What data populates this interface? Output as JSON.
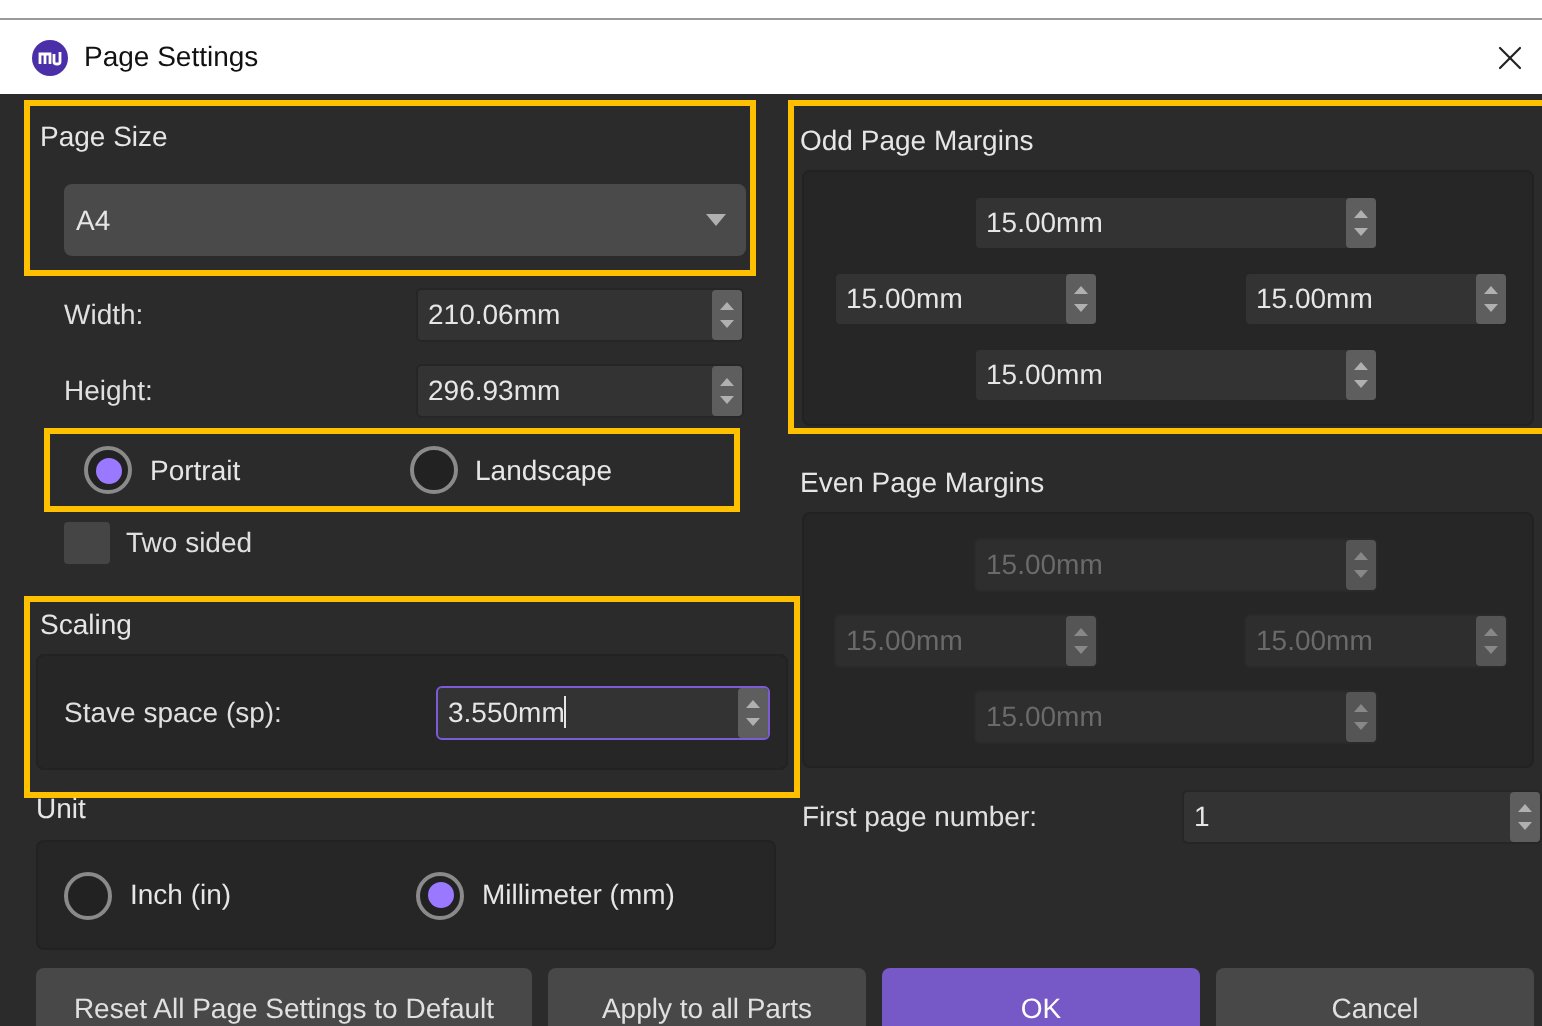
{
  "window": {
    "title": "Page Settings"
  },
  "page_size": {
    "title": "Page Size",
    "highlighted": true,
    "value": "A4",
    "width_label": "Width:",
    "width": "210.06mm",
    "height_label": "Height:",
    "height": "296.93mm"
  },
  "orientation": {
    "highlighted": true,
    "options": [
      {
        "label": "Portrait",
        "selected": true
      },
      {
        "label": "Landscape",
        "selected": false
      }
    ]
  },
  "two_sided": {
    "label": "Two sided",
    "checked": false
  },
  "scaling": {
    "title": "Scaling",
    "highlighted": true,
    "label": "Stave space (sp):",
    "value": "3.550mm",
    "focused": true
  },
  "unit": {
    "title": "Unit",
    "options": [
      {
        "label": "Inch (in)",
        "selected": false
      },
      {
        "label": "Millimeter (mm)",
        "selected": true
      }
    ]
  },
  "odd_margins": {
    "title": "Odd Page Margins",
    "highlighted": true,
    "disabled": false,
    "top": "15.00mm",
    "left": "15.00mm",
    "right": "15.00mm",
    "bottom": "15.00mm"
  },
  "even_margins": {
    "title": "Even Page Margins",
    "highlighted": false,
    "disabled": true,
    "top": "15.00mm",
    "left": "15.00mm",
    "right": "15.00mm",
    "bottom": "15.00mm"
  },
  "first_page_number": {
    "label": "First page number:",
    "value": "1"
  },
  "buttons": [
    {
      "label": "Reset All Page Settings to Default",
      "kind": "normal"
    },
    {
      "label": "Apply to all Parts",
      "kind": "normal"
    },
    {
      "label": "OK",
      "kind": "primary"
    },
    {
      "label": "Cancel",
      "kind": "normal"
    }
  ]
}
